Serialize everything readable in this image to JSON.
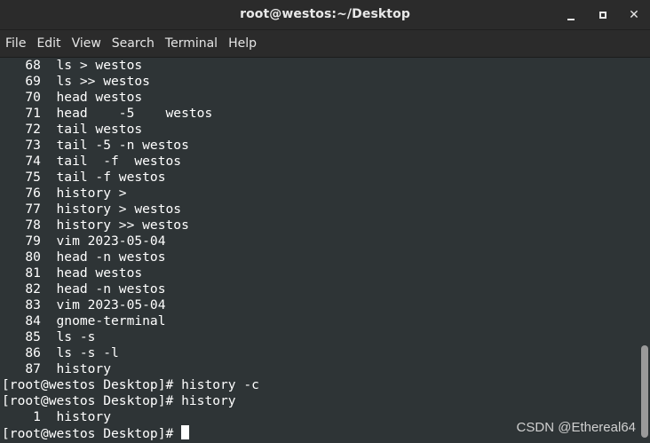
{
  "window": {
    "title": "root@westos:~/Desktop",
    "buttons": {
      "minimize": "minimize",
      "maximize": "maximize",
      "close": "✕"
    }
  },
  "menubar": {
    "items": [
      "File",
      "Edit",
      "View",
      "Search",
      "Terminal",
      "Help"
    ]
  },
  "terminal": {
    "lines": [
      "   68  ls > westos",
      "   69  ls >> westos",
      "   70  head westos",
      "   71  head    -5    westos",
      "   72  tail westos",
      "   73  tail -5 -n westos",
      "   74  tail  -f  westos",
      "   75  tail -f westos",
      "   76  history >",
      "   77  history > westos",
      "   78  history >> westos",
      "   79  vim 2023-05-04",
      "   80  head -n westos",
      "   81  head westos",
      "   82  head -n westos",
      "   83  vim 2023-05-04",
      "   84  gnome-terminal",
      "   85  ls -s",
      "   86  ls -s -l",
      "   87  history",
      "[root@westos Desktop]# history -c",
      "[root@westos Desktop]# history",
      "    1  history"
    ],
    "prompt": "[root@westos Desktop]# "
  },
  "watermark": "CSDN @Ethereal64",
  "colors": {
    "terminal_bg": "#2e3436",
    "text": "#ffffff",
    "chrome_bg": "#2b2b2b"
  }
}
